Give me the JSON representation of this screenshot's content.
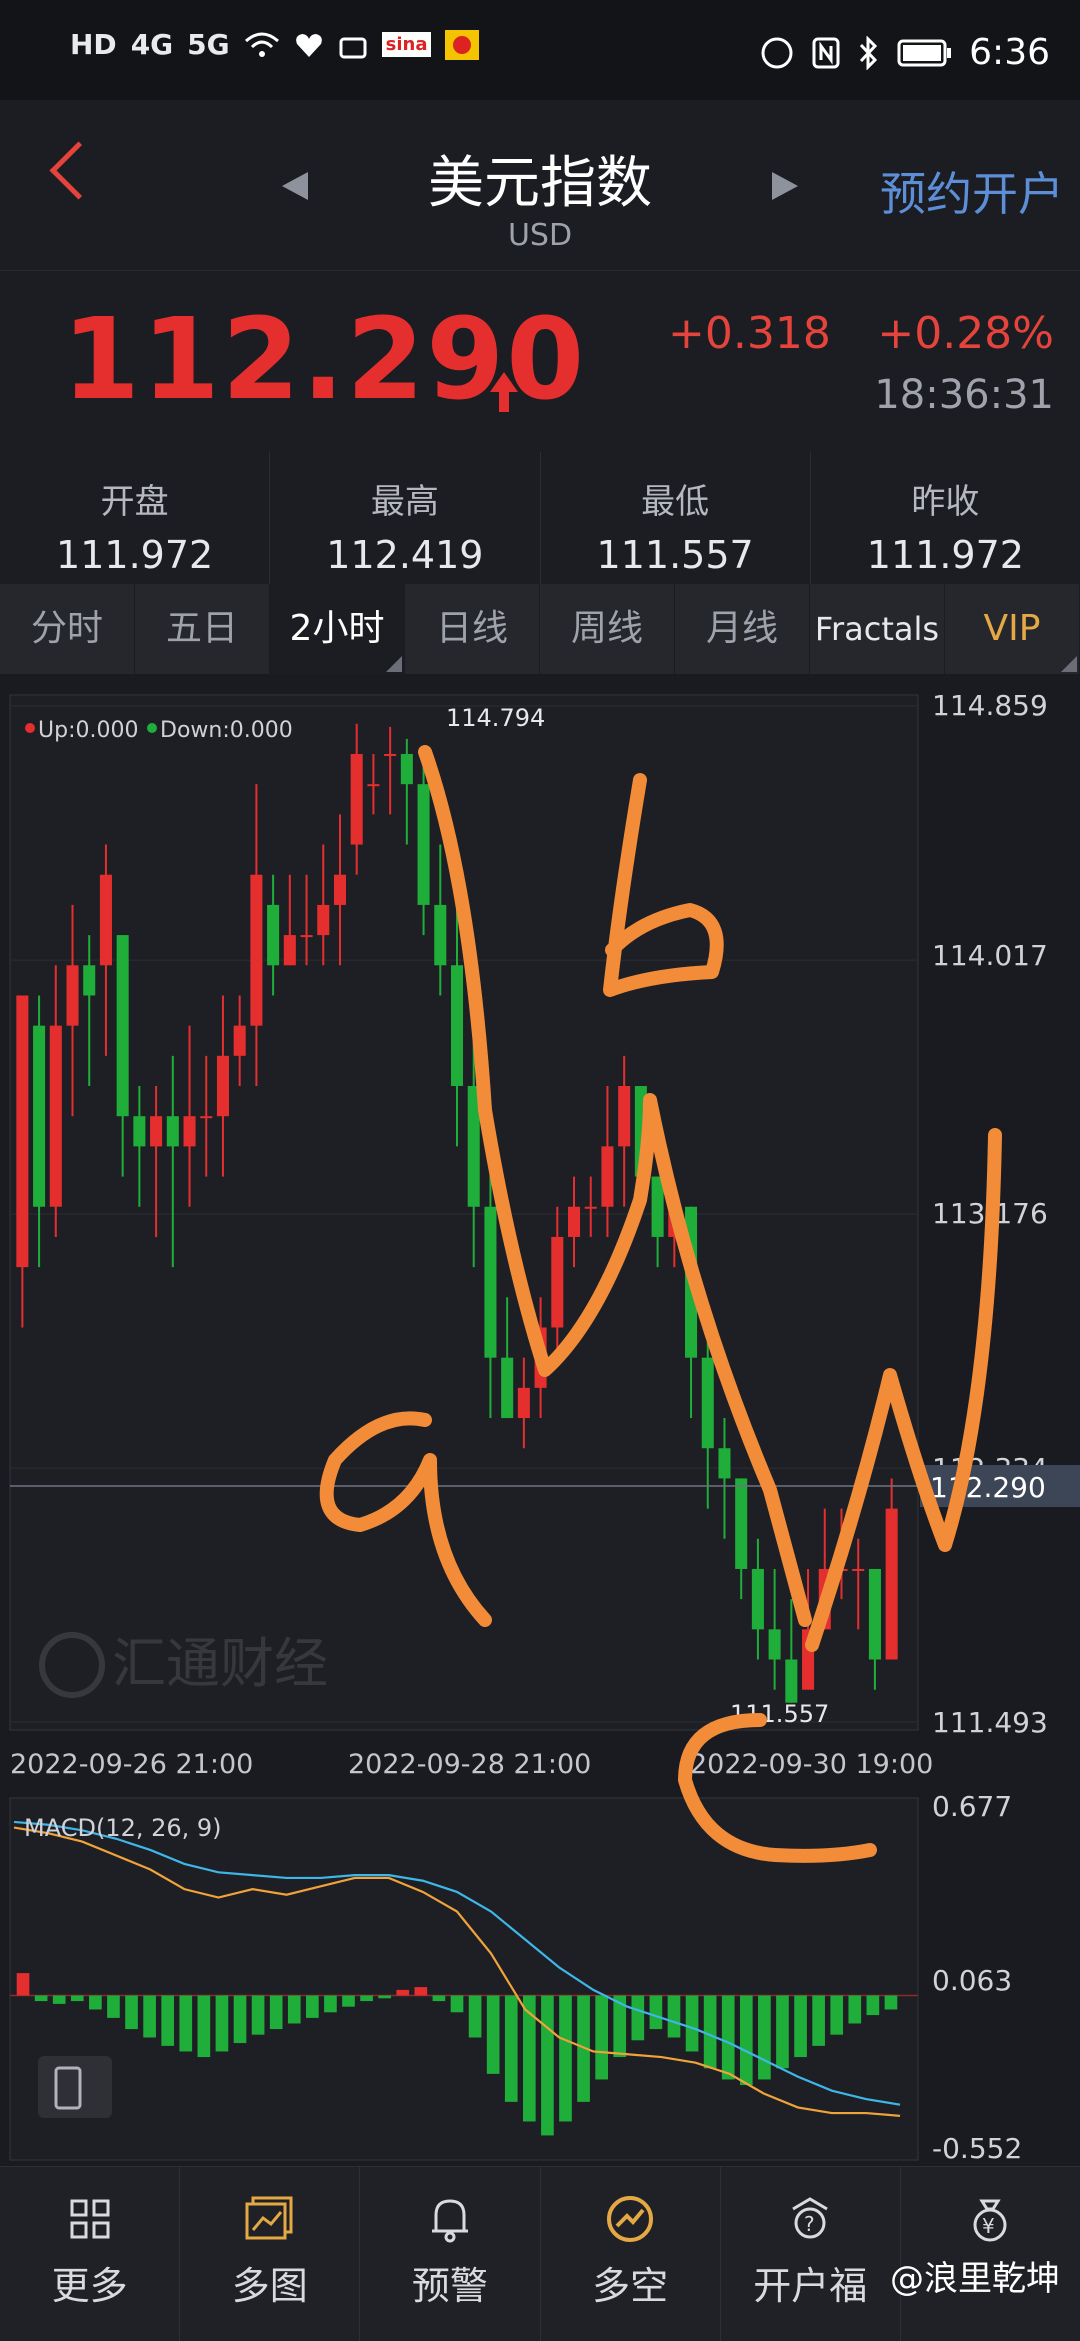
{
  "status": {
    "left": [
      "HD",
      "4G",
      "5G",
      "sina"
    ],
    "clock": "6:36"
  },
  "header": {
    "title": "美元指数",
    "subtitle": "USD",
    "account_button": "预约开户"
  },
  "quote": {
    "price": "112.290",
    "change": "+0.318",
    "change_pct": "+0.28%",
    "time": "18:36:31",
    "colors": {
      "up": "#e52f2f",
      "down": "#1fae3a"
    }
  },
  "stats": [
    {
      "label": "开盘",
      "value": "111.972"
    },
    {
      "label": "最高",
      "value": "112.419"
    },
    {
      "label": "最低",
      "value": "111.557"
    },
    {
      "label": "昨收",
      "value": "111.972"
    }
  ],
  "tabs": [
    "分时",
    "五日",
    "2小时",
    "日线",
    "周线",
    "月线",
    "Fractals",
    "VIP"
  ],
  "chart_data": [
    {
      "type": "candlestick",
      "legend": [
        "Up:0.000",
        "Down:0.000"
      ],
      "y_ticks": [
        "114.859",
        "114.017",
        "113.176",
        "112.334",
        "111.493"
      ],
      "ylim": [
        111.493,
        114.859
      ],
      "x_ticks": [
        "2022-09-26 21:00",
        "2022-09-28 21:00",
        "2022-09-30 19:00"
      ],
      "high_label": "114.794",
      "low_label": "111.557",
      "current_label": "112.290",
      "watermark": "汇通财经",
      "candles": [
        [
          113.0,
          113.9,
          113.6,
          112.8
        ],
        [
          113.8,
          113.2,
          113.9,
          113.0
        ],
        [
          113.2,
          113.8,
          114.0,
          113.1
        ],
        [
          113.8,
          114.0,
          114.2,
          113.5
        ],
        [
          114.0,
          113.9,
          114.1,
          113.6
        ],
        [
          114.0,
          114.3,
          114.4,
          113.7
        ],
        [
          114.1,
          113.5,
          114.1,
          113.3
        ],
        [
          113.5,
          113.4,
          113.6,
          113.2
        ],
        [
          113.4,
          113.5,
          113.6,
          113.1
        ],
        [
          113.5,
          113.4,
          113.7,
          113.0
        ],
        [
          113.4,
          113.5,
          113.8,
          113.2
        ],
        [
          113.5,
          113.5,
          113.7,
          113.3
        ],
        [
          113.5,
          113.7,
          113.9,
          113.3
        ],
        [
          113.7,
          113.8,
          113.9,
          113.6
        ],
        [
          113.8,
          114.3,
          114.6,
          113.6
        ],
        [
          114.2,
          114.0,
          114.3,
          113.9
        ],
        [
          114.0,
          114.1,
          114.3,
          114.0
        ],
        [
          114.1,
          114.1,
          114.3,
          114.0
        ],
        [
          114.1,
          114.2,
          114.4,
          114.0
        ],
        [
          114.2,
          114.3,
          114.5,
          114.0
        ],
        [
          114.4,
          114.7,
          114.8,
          114.3
        ],
        [
          114.6,
          114.6,
          114.7,
          114.5
        ],
        [
          114.7,
          114.7,
          114.79,
          114.5
        ],
        [
          114.7,
          114.6,
          114.75,
          114.4
        ],
        [
          114.6,
          114.2,
          114.7,
          114.1
        ],
        [
          114.2,
          114.0,
          114.4,
          113.9
        ],
        [
          114.0,
          113.6,
          114.2,
          113.4
        ],
        [
          113.6,
          113.2,
          113.8,
          113.0
        ],
        [
          113.2,
          112.7,
          113.4,
          112.5
        ],
        [
          112.7,
          112.5,
          112.9,
          112.5
        ],
        [
          112.5,
          112.6,
          112.7,
          112.4
        ],
        [
          112.6,
          112.8,
          112.9,
          112.5
        ],
        [
          112.8,
          113.1,
          113.2,
          112.7
        ],
        [
          113.1,
          113.2,
          113.3,
          113.0
        ],
        [
          113.2,
          113.2,
          113.3,
          113.1
        ],
        [
          113.2,
          113.4,
          113.6,
          113.1
        ],
        [
          113.4,
          113.6,
          113.7,
          113.2
        ],
        [
          113.6,
          113.3,
          113.6,
          113.2
        ],
        [
          113.3,
          113.1,
          113.3,
          113.0
        ],
        [
          113.1,
          113.2,
          113.2,
          113.0
        ],
        [
          113.2,
          112.7,
          113.2,
          112.5
        ],
        [
          112.7,
          112.4,
          112.8,
          112.2
        ],
        [
          112.4,
          112.3,
          112.5,
          112.1
        ],
        [
          112.3,
          112.0,
          112.3,
          111.9
        ],
        [
          112.0,
          111.8,
          112.1,
          111.7
        ],
        [
          111.8,
          111.7,
          112.0,
          111.6
        ],
        [
          111.7,
          111.557,
          111.9,
          111.557
        ],
        [
          111.6,
          111.8,
          112.0,
          111.6
        ],
        [
          111.8,
          112.0,
          112.2,
          111.8
        ],
        [
          112.0,
          112.0,
          112.2,
          111.9
        ],
        [
          112.0,
          112.0,
          112.1,
          111.8
        ],
        [
          112.0,
          111.7,
          112.0,
          111.6
        ],
        [
          111.7,
          112.2,
          112.3,
          111.7
        ]
      ]
    },
    {
      "type": "macd",
      "label": "MACD(12, 26, 9)",
      "y_ticks": [
        "0.677",
        "0.063",
        "-0.552"
      ],
      "ylim": [
        -0.552,
        0.677
      ],
      "histogram": [
        0.08,
        -0.02,
        -0.03,
        -0.02,
        -0.05,
        -0.08,
        -0.12,
        -0.15,
        -0.18,
        -0.2,
        -0.22,
        -0.2,
        -0.17,
        -0.14,
        -0.12,
        -0.1,
        -0.08,
        -0.06,
        -0.04,
        -0.02,
        -0.01,
        0.02,
        0.03,
        -0.02,
        -0.06,
        -0.15,
        -0.28,
        -0.38,
        -0.45,
        -0.5,
        -0.45,
        -0.38,
        -0.3,
        -0.22,
        -0.16,
        -0.12,
        -0.15,
        -0.2,
        -0.26,
        -0.3,
        -0.32,
        -0.3,
        -0.26,
        -0.22,
        -0.18,
        -0.14,
        -0.1,
        -0.07,
        -0.05
      ],
      "dif": [
        0.6,
        0.58,
        0.55,
        0.5,
        0.45,
        0.38,
        0.35,
        0.38,
        0.36,
        0.39,
        0.42,
        0.42,
        0.37,
        0.3,
        0.15,
        -0.05,
        -0.15,
        -0.2,
        -0.21,
        -0.22,
        -0.24,
        -0.28,
        -0.35,
        -0.4,
        -0.42,
        -0.42,
        -0.43
      ],
      "dea": [
        0.62,
        0.61,
        0.59,
        0.56,
        0.52,
        0.47,
        0.44,
        0.43,
        0.42,
        0.42,
        0.43,
        0.43,
        0.41,
        0.37,
        0.3,
        0.2,
        0.1,
        0.02,
        -0.04,
        -0.08,
        -0.12,
        -0.17,
        -0.23,
        -0.29,
        -0.34,
        -0.37,
        -0.39
      ]
    }
  ],
  "nav": [
    {
      "label": "更多",
      "icon": "grid-icon"
    },
    {
      "label": "多图",
      "icon": "multi-chart-icon"
    },
    {
      "label": "预警",
      "icon": "bell-icon"
    },
    {
      "label": "多空",
      "icon": "trend-icon"
    },
    {
      "label": "开户福",
      "icon": "gift-icon"
    },
    {
      "label": "",
      "icon": "money-bag-icon"
    }
  ],
  "footer_watermark": "@浪里乾坤"
}
